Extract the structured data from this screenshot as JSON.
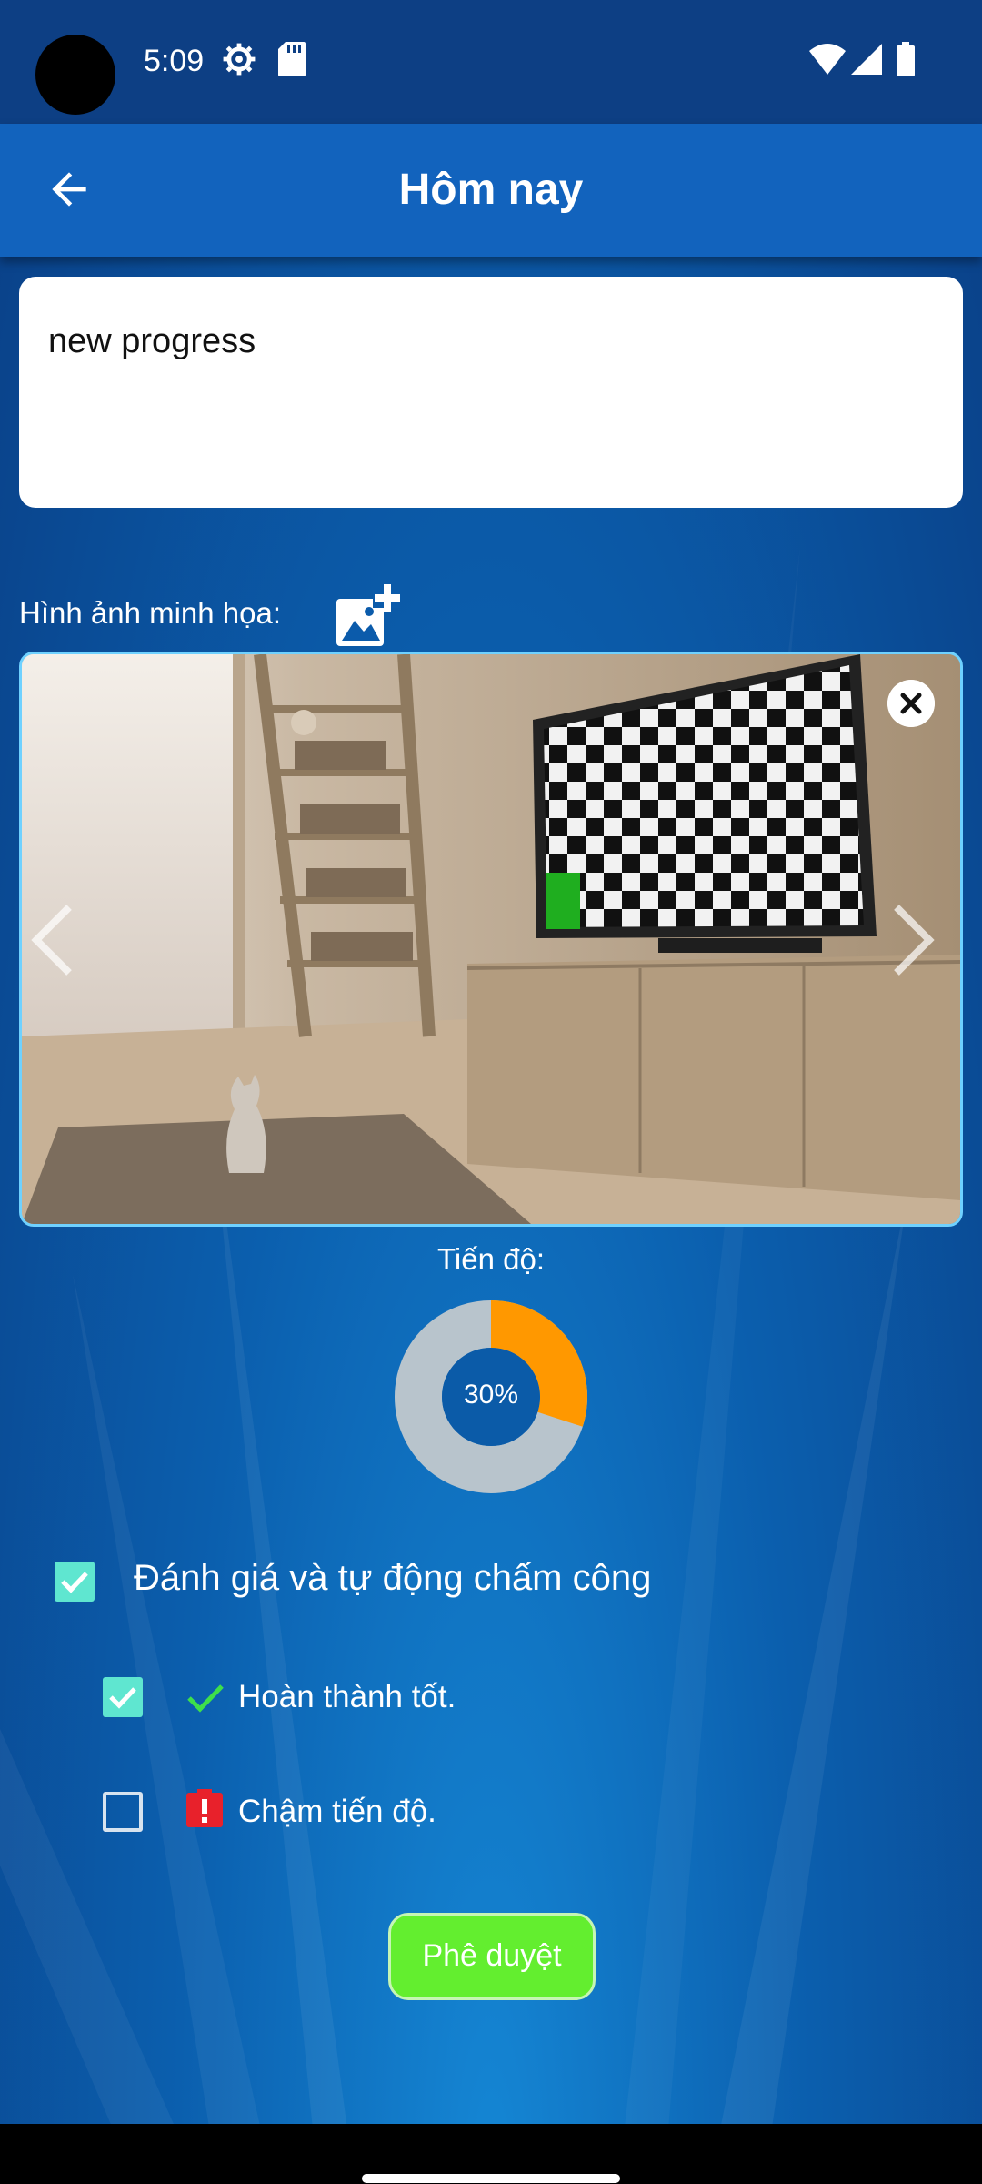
{
  "status_bar": {
    "time": "5:09"
  },
  "app_bar": {
    "title": "Hôm nay"
  },
  "description": {
    "value": "new progress"
  },
  "images": {
    "label": "Hình ảnh minh họa:"
  },
  "progress": {
    "label": "Tiến độ:",
    "percent": 30,
    "percent_text": "30%"
  },
  "evaluation": {
    "main_label": "Đánh giá và tự động chấm công",
    "main_checked": true,
    "options": [
      {
        "label": "Hoàn thành tốt.",
        "checked": true,
        "icon": "check-icon"
      },
      {
        "label": "Chậm tiến độ.",
        "checked": false,
        "icon": "alert-icon"
      }
    ]
  },
  "actions": {
    "approve_label": "Phê duyệt"
  },
  "colors": {
    "app_bar": "#1263bd",
    "status_bar": "#0d3f84",
    "donut_fill": "#ff9800",
    "donut_track": "#b8c4cc",
    "donut_center": "#0b5ba8",
    "checkbox_checked": "#5fe6d0",
    "approve_button": "#63ee2f",
    "gallery_border": "#6fd1ff"
  }
}
